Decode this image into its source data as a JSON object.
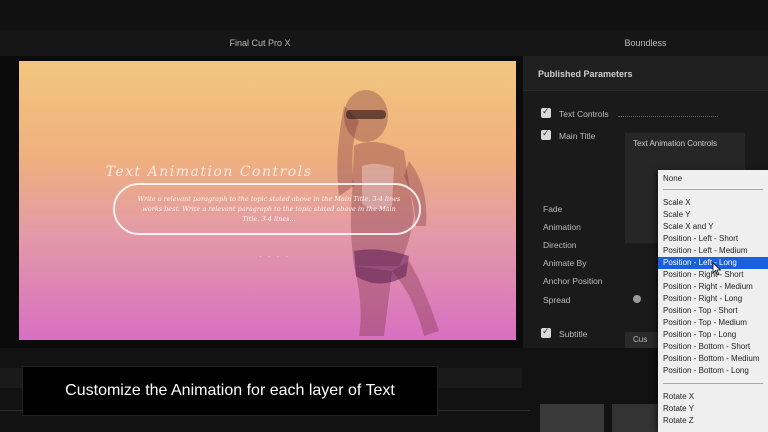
{
  "header": {
    "app_title": "Final Cut Pro X",
    "plugin_title": "Boundless"
  },
  "viewer": {
    "title_text": "Text Animation Controls",
    "body_text": "Write a relevant paragraph to the topic stated above in the Main Title. 3-4 lines works best. Write a relevant paragraph to the topic stated above in the Main Title. 3-4 lines..."
  },
  "inspector": {
    "header": "Published Parameters",
    "text_controls": "Text Controls",
    "main_title": "Main Title",
    "animation_controls": "Text Animation Controls",
    "params": [
      "Fade",
      "Animation",
      "Direction",
      "Animate By",
      "Anchor Position",
      "Spread"
    ],
    "subtitle": "Subtitle",
    "cus_label": "Cus"
  },
  "menu": {
    "none_label": "None",
    "items": [
      "Scale X",
      "Scale Y",
      "Scale X and Y",
      "Position - Left - Short",
      "Position - Left - Medium",
      "Position - Left - Long",
      "Position - Right - Short",
      "Position - Right - Medium",
      "Position - Right - Long",
      "Position - Top - Short",
      "Position - Top - Medium",
      "Position - Top - Long",
      "Position - Bottom - Short",
      "Position - Bottom - Medium",
      "Position - Bottom - Long"
    ],
    "selected": "Position - Left - Long",
    "rotate_items": [
      "Rotate X",
      "Rotate Y",
      "Rotate Z"
    ]
  },
  "caption": "Customize the Animation for each layer of Text",
  "colors": {
    "selection": "#1a5fe0",
    "menu_bg": "#efefef",
    "canvas_top": "#f2c77f",
    "canvas_bottom": "#d86fc2"
  }
}
